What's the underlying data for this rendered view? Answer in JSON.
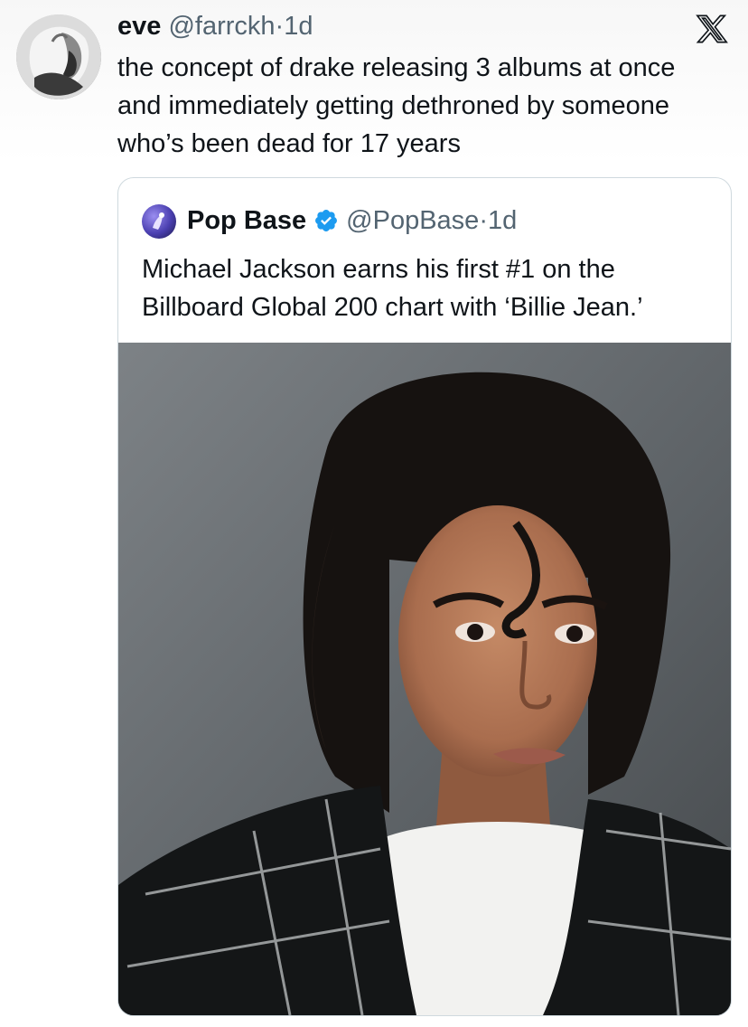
{
  "tweet": {
    "name": "eve",
    "handle": "@farrckh",
    "separator": "·",
    "time": "1d",
    "text": "the concept of drake releasing 3 albums at once and immediately getting dethroned by someone who’s been dead for 17 years",
    "avatar_icon": "user-avatar"
  },
  "brand": {
    "logo_icon": "x-logo-icon"
  },
  "quote": {
    "name": "Pop Base",
    "handle": "@PopBase",
    "separator": "·",
    "time": "1d",
    "verified_icon": "verified-badge-icon",
    "verified_color": "#1d9bf0",
    "text": "Michael Jackson earns his first #1 on the Billboard Global 200 chart with ‘Billie Jean.’",
    "media_icon": "portrait-photo"
  }
}
